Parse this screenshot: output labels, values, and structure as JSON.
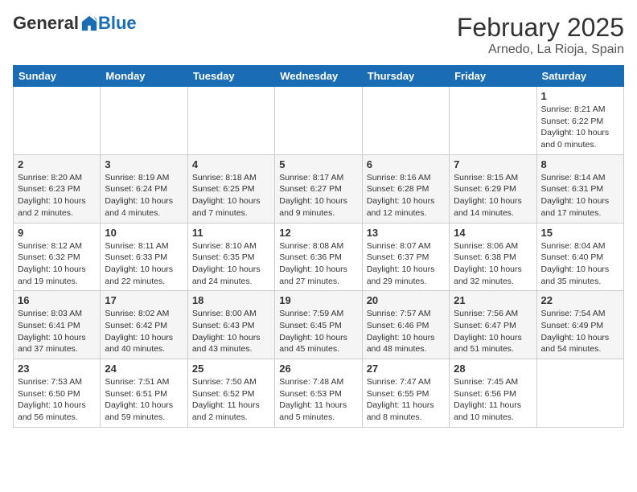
{
  "header": {
    "logo_general": "General",
    "logo_blue": "Blue",
    "month_year": "February 2025",
    "location": "Arnedo, La Rioja, Spain"
  },
  "weekdays": [
    "Sunday",
    "Monday",
    "Tuesday",
    "Wednesday",
    "Thursday",
    "Friday",
    "Saturday"
  ],
  "weeks": [
    [
      {
        "day": "",
        "info": ""
      },
      {
        "day": "",
        "info": ""
      },
      {
        "day": "",
        "info": ""
      },
      {
        "day": "",
        "info": ""
      },
      {
        "day": "",
        "info": ""
      },
      {
        "day": "",
        "info": ""
      },
      {
        "day": "1",
        "info": "Sunrise: 8:21 AM\nSunset: 6:22 PM\nDaylight: 10 hours\nand 0 minutes."
      }
    ],
    [
      {
        "day": "2",
        "info": "Sunrise: 8:20 AM\nSunset: 6:23 PM\nDaylight: 10 hours\nand 2 minutes."
      },
      {
        "day": "3",
        "info": "Sunrise: 8:19 AM\nSunset: 6:24 PM\nDaylight: 10 hours\nand 4 minutes."
      },
      {
        "day": "4",
        "info": "Sunrise: 8:18 AM\nSunset: 6:25 PM\nDaylight: 10 hours\nand 7 minutes."
      },
      {
        "day": "5",
        "info": "Sunrise: 8:17 AM\nSunset: 6:27 PM\nDaylight: 10 hours\nand 9 minutes."
      },
      {
        "day": "6",
        "info": "Sunrise: 8:16 AM\nSunset: 6:28 PM\nDaylight: 10 hours\nand 12 minutes."
      },
      {
        "day": "7",
        "info": "Sunrise: 8:15 AM\nSunset: 6:29 PM\nDaylight: 10 hours\nand 14 minutes."
      },
      {
        "day": "8",
        "info": "Sunrise: 8:14 AM\nSunset: 6:31 PM\nDaylight: 10 hours\nand 17 minutes."
      }
    ],
    [
      {
        "day": "9",
        "info": "Sunrise: 8:12 AM\nSunset: 6:32 PM\nDaylight: 10 hours\nand 19 minutes."
      },
      {
        "day": "10",
        "info": "Sunrise: 8:11 AM\nSunset: 6:33 PM\nDaylight: 10 hours\nand 22 minutes."
      },
      {
        "day": "11",
        "info": "Sunrise: 8:10 AM\nSunset: 6:35 PM\nDaylight: 10 hours\nand 24 minutes."
      },
      {
        "day": "12",
        "info": "Sunrise: 8:08 AM\nSunset: 6:36 PM\nDaylight: 10 hours\nand 27 minutes."
      },
      {
        "day": "13",
        "info": "Sunrise: 8:07 AM\nSunset: 6:37 PM\nDaylight: 10 hours\nand 29 minutes."
      },
      {
        "day": "14",
        "info": "Sunrise: 8:06 AM\nSunset: 6:38 PM\nDaylight: 10 hours\nand 32 minutes."
      },
      {
        "day": "15",
        "info": "Sunrise: 8:04 AM\nSunset: 6:40 PM\nDaylight: 10 hours\nand 35 minutes."
      }
    ],
    [
      {
        "day": "16",
        "info": "Sunrise: 8:03 AM\nSunset: 6:41 PM\nDaylight: 10 hours\nand 37 minutes."
      },
      {
        "day": "17",
        "info": "Sunrise: 8:02 AM\nSunset: 6:42 PM\nDaylight: 10 hours\nand 40 minutes."
      },
      {
        "day": "18",
        "info": "Sunrise: 8:00 AM\nSunset: 6:43 PM\nDaylight: 10 hours\nand 43 minutes."
      },
      {
        "day": "19",
        "info": "Sunrise: 7:59 AM\nSunset: 6:45 PM\nDaylight: 10 hours\nand 45 minutes."
      },
      {
        "day": "20",
        "info": "Sunrise: 7:57 AM\nSunset: 6:46 PM\nDaylight: 10 hours\nand 48 minutes."
      },
      {
        "day": "21",
        "info": "Sunrise: 7:56 AM\nSunset: 6:47 PM\nDaylight: 10 hours\nand 51 minutes."
      },
      {
        "day": "22",
        "info": "Sunrise: 7:54 AM\nSunset: 6:49 PM\nDaylight: 10 hours\nand 54 minutes."
      }
    ],
    [
      {
        "day": "23",
        "info": "Sunrise: 7:53 AM\nSunset: 6:50 PM\nDaylight: 10 hours\nand 56 minutes."
      },
      {
        "day": "24",
        "info": "Sunrise: 7:51 AM\nSunset: 6:51 PM\nDaylight: 10 hours\nand 59 minutes."
      },
      {
        "day": "25",
        "info": "Sunrise: 7:50 AM\nSunset: 6:52 PM\nDaylight: 11 hours\nand 2 minutes."
      },
      {
        "day": "26",
        "info": "Sunrise: 7:48 AM\nSunset: 6:53 PM\nDaylight: 11 hours\nand 5 minutes."
      },
      {
        "day": "27",
        "info": "Sunrise: 7:47 AM\nSunset: 6:55 PM\nDaylight: 11 hours\nand 8 minutes."
      },
      {
        "day": "28",
        "info": "Sunrise: 7:45 AM\nSunset: 6:56 PM\nDaylight: 11 hours\nand 10 minutes."
      },
      {
        "day": "",
        "info": ""
      }
    ]
  ]
}
